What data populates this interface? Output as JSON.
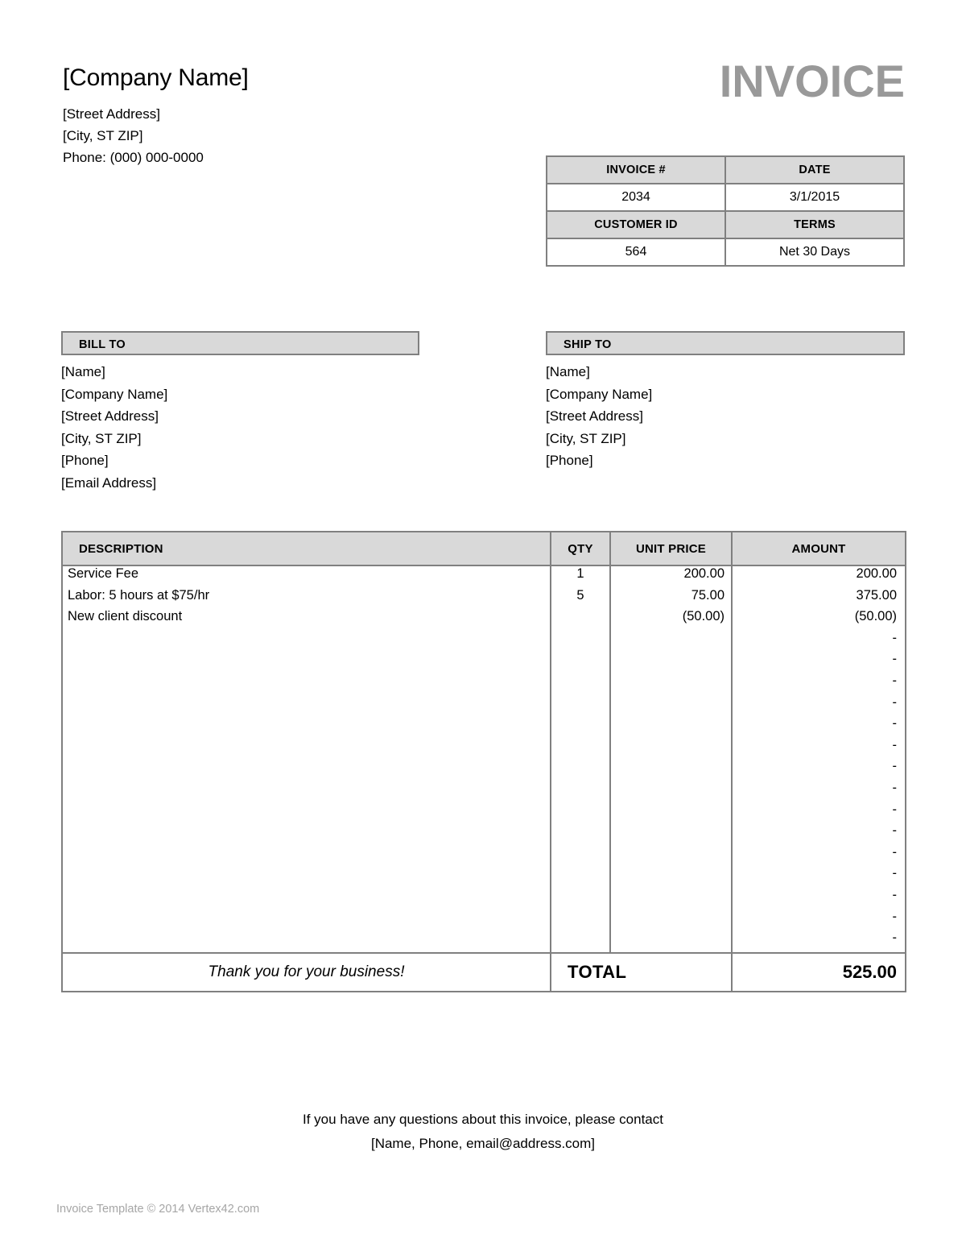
{
  "document_title": "INVOICE",
  "colors": {
    "header_fill": "#D9D9D9",
    "border": "#808080",
    "title_gray": "#999999",
    "copyright_gray": "#A6A6A6"
  },
  "company": {
    "name": "[Company Name]",
    "lines": [
      "[Street Address]",
      "[City, ST  ZIP]",
      "Phone: (000) 000-0000"
    ]
  },
  "meta": {
    "invoice_number_label": "INVOICE #",
    "invoice_number_value": "2034",
    "date_label": "DATE",
    "date_value": "3/1/2015",
    "customer_id_label": "CUSTOMER ID",
    "customer_id_value": "564",
    "terms_label": "TERMS",
    "terms_value": "Net 30 Days"
  },
  "bill_to": {
    "header": "BILL TO",
    "lines": [
      "[Name]",
      "[Company Name]",
      "[Street Address]",
      "[City, ST  ZIP]",
      "[Phone]",
      "[Email Address]"
    ]
  },
  "ship_to": {
    "header": "SHIP TO",
    "lines": [
      "[Name]",
      "[Company Name]",
      "[Street Address]",
      "[City, ST  ZIP]",
      "[Phone]"
    ]
  },
  "items_table": {
    "columns": [
      "DESCRIPTION",
      "QTY",
      "UNIT PRICE",
      "AMOUNT"
    ],
    "rows": [
      {
        "description": "Service Fee",
        "qty": "1",
        "unit_price": "200.00",
        "amount": "200.00"
      },
      {
        "description": "Labor: 5 hours at $75/hr",
        "qty": "5",
        "unit_price": "75.00",
        "amount": "375.00"
      },
      {
        "description": "New client discount",
        "qty": "",
        "unit_price": "(50.00)",
        "amount": "(50.00)"
      },
      {
        "description": "",
        "qty": "",
        "unit_price": "",
        "amount": "-"
      },
      {
        "description": "",
        "qty": "",
        "unit_price": "",
        "amount": "-"
      },
      {
        "description": "",
        "qty": "",
        "unit_price": "",
        "amount": "-"
      },
      {
        "description": "",
        "qty": "",
        "unit_price": "",
        "amount": "-"
      },
      {
        "description": "",
        "qty": "",
        "unit_price": "",
        "amount": "-"
      },
      {
        "description": "",
        "qty": "",
        "unit_price": "",
        "amount": "-"
      },
      {
        "description": "",
        "qty": "",
        "unit_price": "",
        "amount": "-"
      },
      {
        "description": "",
        "qty": "",
        "unit_price": "",
        "amount": "-"
      },
      {
        "description": "",
        "qty": "",
        "unit_price": "",
        "amount": "-"
      },
      {
        "description": "",
        "qty": "",
        "unit_price": "",
        "amount": "-"
      },
      {
        "description": "",
        "qty": "",
        "unit_price": "",
        "amount": "-"
      },
      {
        "description": "",
        "qty": "",
        "unit_price": "",
        "amount": "-"
      },
      {
        "description": "",
        "qty": "",
        "unit_price": "",
        "amount": "-"
      },
      {
        "description": "",
        "qty": "",
        "unit_price": "",
        "amount": "-"
      },
      {
        "description": "",
        "qty": "",
        "unit_price": "",
        "amount": "-"
      }
    ],
    "footer": {
      "message": "Thank you for your business!",
      "total_label": "TOTAL",
      "total_value": "525.00"
    }
  },
  "contact_note": {
    "line1": "If you have any questions about this invoice, please contact",
    "line2": "[Name, Phone, email@address.com]"
  },
  "copyright": "Invoice Template © 2014 Vertex42.com"
}
